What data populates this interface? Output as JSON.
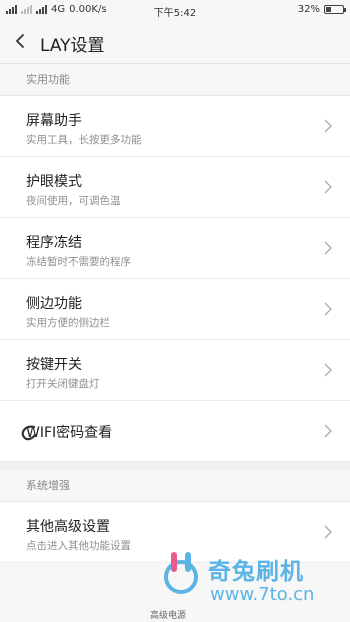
{
  "status_bar": {
    "network": "4G",
    "speed": "0.00K/s",
    "time": "下午5:42",
    "battery": "32%",
    "battery_level": 0.32
  },
  "header": {
    "title": "LAY设置"
  },
  "sections": [
    {
      "title": "实用功能",
      "items": [
        {
          "title": "屏幕助手",
          "subtitle": "实用工具，长按更多功能"
        },
        {
          "title": "护眼模式",
          "subtitle": "夜间使用，可调色温"
        },
        {
          "title": "程序冻结",
          "subtitle": "冻结暂时不需要的程序"
        },
        {
          "title": "侧边功能",
          "subtitle": "实用方便的侧边栏"
        },
        {
          "title": "按键开关",
          "subtitle": "打开关闭键盘灯"
        },
        {
          "title": "WIFI密码查看"
        }
      ]
    },
    {
      "title": "系统增强",
      "items": [
        {
          "title": "其他高级设置",
          "subtitle": "点击进入其他功能设置"
        }
      ]
    }
  ],
  "watermark": {
    "brand": "奇兔刷机",
    "url": "www.7to.cn",
    "caption": "高级电源"
  }
}
